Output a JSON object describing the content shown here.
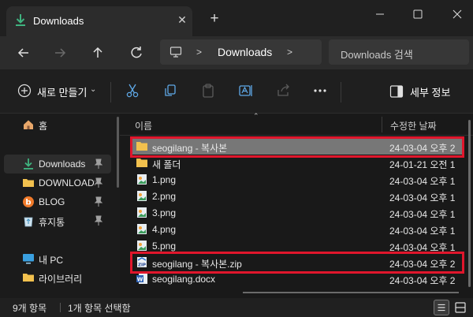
{
  "window": {
    "tab_title": "Downloads",
    "tab_close_glyph": "✕",
    "new_tab_glyph": "+",
    "minimize_glyph": "—",
    "maximize_glyph": "☐",
    "close_glyph": "✕"
  },
  "address_bar": {
    "location": "Downloads",
    "separator": ">",
    "search_placeholder": "Downloads 검색"
  },
  "toolbar": {
    "new_label": "새로 만들기",
    "new_chevron": "⌄",
    "details_label": "세부 정보",
    "more_glyph": "···"
  },
  "sidebar": {
    "items": [
      {
        "label": "홈",
        "icon": "home-icon"
      },
      {
        "label": "Downloads",
        "icon": "download-icon",
        "pinned": true,
        "selected": true
      },
      {
        "label": "DOWNLOADS",
        "icon": "folder-icon",
        "pinned": true
      },
      {
        "label": "BLOG",
        "icon": "blog-icon",
        "pinned": true
      },
      {
        "label": "휴지통",
        "icon": "recycle-bin-icon",
        "pinned": true
      },
      {
        "label": "내 PC",
        "icon": "pc-icon"
      },
      {
        "label": "라이브러리",
        "icon": "library-folder-icon"
      }
    ]
  },
  "file_list": {
    "columns": {
      "name": "이름",
      "date": "수정한 날짜"
    },
    "rows": [
      {
        "name": "seogilang - 복사본",
        "date": "24-03-04 오후 2:",
        "icon": "folder-icon",
        "selected": true,
        "highlighted": true
      },
      {
        "name": "새 폴더",
        "date": "24-01-21 오전 1:",
        "icon": "folder-icon"
      },
      {
        "name": "1.png",
        "date": "24-03-04 오후 1:",
        "icon": "image-file-icon"
      },
      {
        "name": "2.png",
        "date": "24-03-04 오후 1:",
        "icon": "image-file-icon"
      },
      {
        "name": "3.png",
        "date": "24-03-04 오후 1:",
        "icon": "image-file-icon"
      },
      {
        "name": "4.png",
        "date": "24-03-04 오후 1:",
        "icon": "image-file-icon"
      },
      {
        "name": "5.png",
        "date": "24-03-04 오후 1:",
        "icon": "image-file-icon"
      },
      {
        "name": "seogilang - 복사본.zip",
        "date": "24-03-04 오후 2:",
        "icon": "zip-file-icon",
        "highlighted": true
      },
      {
        "name": "seogilang.docx",
        "date": "24-03-04 오후 2:",
        "icon": "word-file-icon"
      }
    ]
  },
  "status_bar": {
    "item_count": "9개 항목",
    "selection": "1개 항목 선택함"
  },
  "colors": {
    "highlight_border": "#e0162c",
    "selected_row": "#777777",
    "accent_green": "#3fb37f",
    "folder_yellow": "#f2c14e"
  }
}
